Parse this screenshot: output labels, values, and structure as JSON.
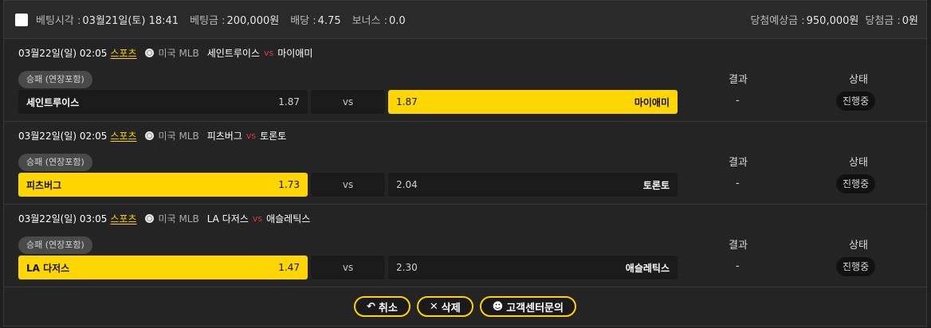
{
  "header": {
    "bet_time_label": "베팅시각 :",
    "bet_time_value": "03월21일(토) 18:41",
    "bet_amount_label": "베팅금 :",
    "bet_amount_value": "200,000원",
    "odds_label": "배당 :",
    "odds_value": "4.75",
    "bonus_label": "보너스 :",
    "bonus_value": "0.0",
    "expected_label": "당첨예상금 :",
    "expected_value": "950,000원",
    "win_label": "당첨금 :",
    "win_value": "0원"
  },
  "columns": {
    "result": "결과",
    "status": "상태"
  },
  "matches": [
    {
      "datetime": "03월22일(일) 02:05",
      "category": "스포츠",
      "league": "미국 MLB",
      "home": "세인트루이스",
      "vs": "vs",
      "away": "마이애미",
      "market": "승패 (연장포함)",
      "home_odds": "1.87",
      "mid": "vs",
      "away_odds": "1.87",
      "selected": "away",
      "result": "-",
      "status": "진행중"
    },
    {
      "datetime": "03월22일(일) 02:05",
      "category": "스포츠",
      "league": "미국 MLB",
      "home": "피츠버그",
      "vs": "vs",
      "away": "토론토",
      "market": "승패 (연장포함)",
      "home_odds": "1.73",
      "mid": "vs",
      "away_odds": "2.04",
      "selected": "home",
      "result": "-",
      "status": "진행중"
    },
    {
      "datetime": "03월22일(일) 03:05",
      "category": "스포츠",
      "league": "미국 MLB",
      "home": "LA 다저스",
      "vs": "vs",
      "away": "애슬레틱스",
      "market": "승패 (연장포함)",
      "home_odds": "1.47",
      "mid": "vs",
      "away_odds": "2.30",
      "selected": "home",
      "result": "-",
      "status": "진행중"
    }
  ],
  "footer": {
    "cancel_label": "취소",
    "delete_label": "삭제",
    "support_label": "고객센터문의"
  },
  "colors": {
    "accent": "#ffd600",
    "vs_red": "#e03a3a"
  }
}
